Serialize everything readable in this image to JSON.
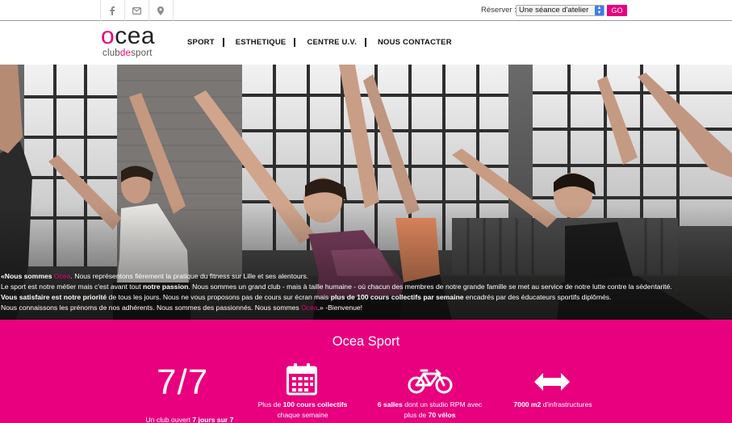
{
  "topbar": {
    "icons": [
      "facebook-icon",
      "envelope-icon",
      "map-pin-icon"
    ],
    "reserve_label": "Réserver :",
    "reserve_select_value": "Une séance d'atelier",
    "go_label": "GO"
  },
  "header": {
    "logo_word_prefix": "o",
    "logo_word_rest": "cea",
    "logo_sub_1": "club",
    "logo_sub_2": "de",
    "logo_sub_3": "sport",
    "nav": [
      "SPORT",
      "ESTHETIQUE",
      "CENTRE U.V.",
      "NOUS CONTACTER"
    ]
  },
  "hero": {
    "p1_b": "«Nous sommes ",
    "p1_brand": "Ocea",
    "p1_rest": ". Nous représentons fièrement la pratique du fitness sur Lille et ses alentours.",
    "p2_a": "Le sport est notre métier mais c'est avant tout ",
    "p2_b": "notre passion",
    "p2_c": ". Nous sommes un grand club - mais à taille humaine - où chacun des membres de notre grande famille se met au service de notre lutte contre la sédentarité.",
    "p3_b1": "Vous satisfaire est notre priorité",
    "p3_a": " de tous les jours. Nous ne vous proposons pas de cours sur écran mais ",
    "p3_b2": "plus de 100 cours collectifs par semaine",
    "p3_c": " encadrés par des éducateurs sportifs diplômés.",
    "p4_a": "Nous connaissons les prénoms de nos adhérents. Nous sommes des passionnés. Nous sommes ",
    "p4_brand": "Ocea",
    "p4_c": ".» -Bienvenue!"
  },
  "sport": {
    "title": "Ocea Sport",
    "big_number": "7/7",
    "f1_a": "Un club ouvert ",
    "f1_b": "7 jours sur 7",
    "f2_a": "Plus de ",
    "f2_b": "100 cours collectifs",
    "f2_c": "chaque semaine",
    "f3_b1": "6 salles",
    "f3_a": " dont un studio RPM avec",
    "f3_c": "plus de ",
    "f3_b2": "70 vélos",
    "f4_b": "7000 m2",
    "f4_a": " d'infrastructures",
    "icons": [
      "calendar-icon",
      "bicycle-icon",
      "arrows-horizontal-icon"
    ]
  },
  "colors": {
    "brand_pink": "#e8007f",
    "go_button": "#e8007f"
  }
}
